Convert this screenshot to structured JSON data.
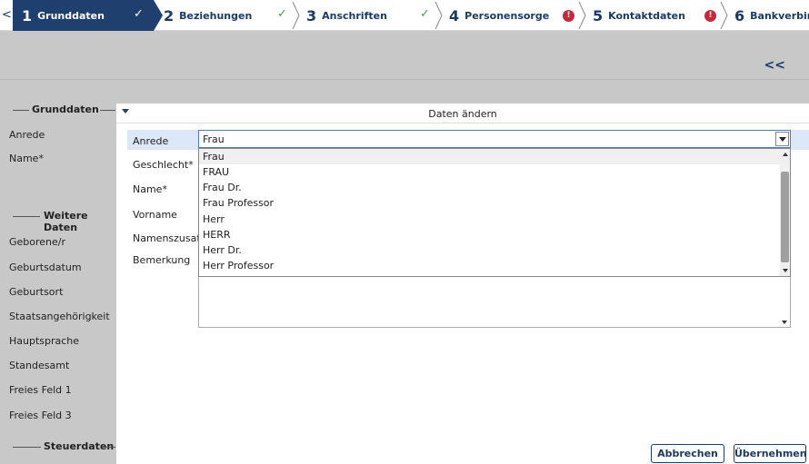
{
  "wizard": {
    "back": "<",
    "steps": [
      {
        "num": "1",
        "label": "Grunddaten",
        "status": "✓"
      },
      {
        "num": "2",
        "label": "Beziehungen",
        "status": "✓"
      },
      {
        "num": "3",
        "label": "Anschriften",
        "status": "✓"
      },
      {
        "num": "4",
        "label": "Personensorge",
        "status": "!"
      },
      {
        "num": "5",
        "label": "Kontaktdaten",
        "status": "!"
      },
      {
        "num": "6",
        "label": "Bankverbindu"
      }
    ]
  },
  "toolbar": {
    "collapse": "<<"
  },
  "left": {
    "sections": [
      "Grunddaten",
      "Weitere Daten",
      "Steuerdaten"
    ],
    "grunddaten_fields": [
      "Anrede",
      "Name*"
    ],
    "weitere_fields": [
      "Geborene/r",
      "Geburtsdatum",
      "Geburtsort",
      "Staatsangehörigkeit",
      "Hauptsprache",
      "Standesamt",
      "Freies Feld 1",
      "Freies Feld 3"
    ]
  },
  "dialog": {
    "title": "Daten ändern",
    "labels": [
      "Anrede",
      "Geschlecht*",
      "Name*",
      "Vorname",
      "Namenszusatz",
      "Bemerkung"
    ],
    "anrede_value": "Frau",
    "options": [
      "Frau",
      "FRAU",
      "Frau Dr.",
      "Frau Professor",
      "Herr",
      "HERR",
      "Herr Dr.",
      "Herr Professor"
    ],
    "highlighted_options": [
      "FRAU",
      "HERR"
    ],
    "cancel": "Abbrechen",
    "apply": "Übernehmen"
  },
  "colors": {
    "accent": "#1f3f6e",
    "ok": "#4aa05a",
    "error": "#c8283a",
    "highlight": "#f5f500"
  }
}
